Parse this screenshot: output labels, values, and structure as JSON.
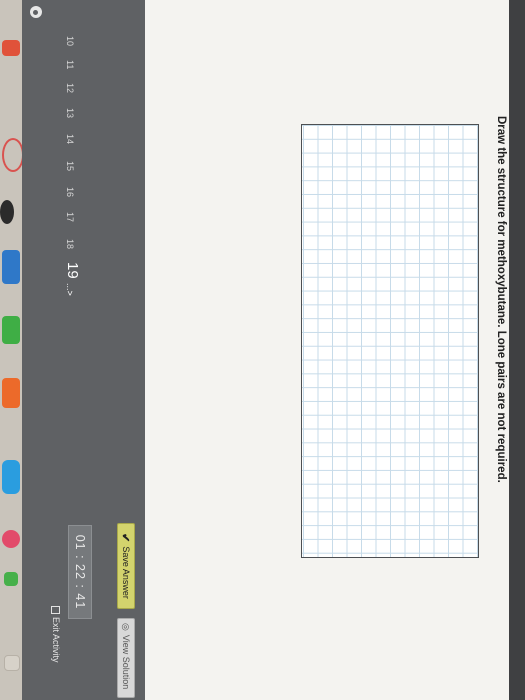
{
  "question": {
    "prompt": "Draw the structure for methoxybutane. Lone pairs are not required."
  },
  "actions": {
    "save_label": "Save Answer",
    "view_label": "View Solution"
  },
  "timer": {
    "value": "01 : 22 : 41"
  },
  "pagination": {
    "pages": [
      "10",
      "11",
      "12",
      "13",
      "14",
      "15",
      "16",
      "17",
      "18"
    ],
    "current": "19",
    "more": "...>"
  },
  "exit": {
    "label": "Exit Activity"
  },
  "colors": {
    "save_button": "#d3d36d",
    "grid_line": "#c7dbe9",
    "bar": "#5f6164"
  }
}
